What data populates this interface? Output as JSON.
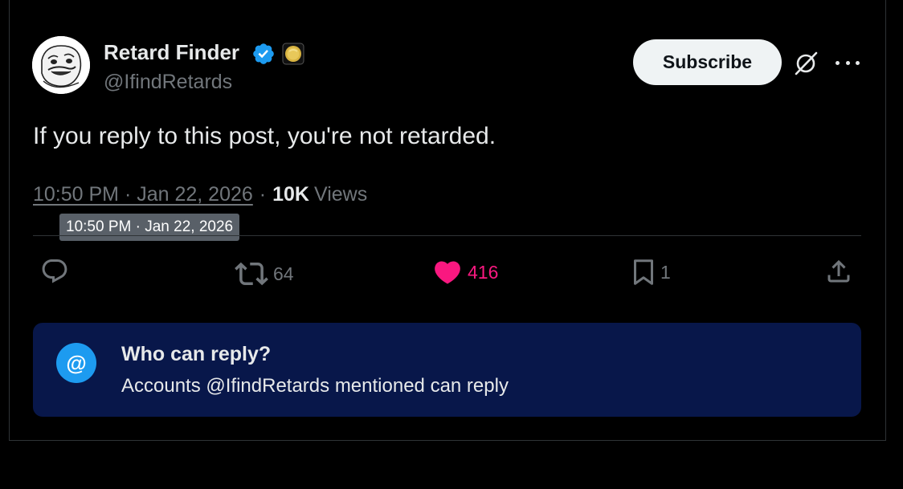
{
  "author": {
    "display_name": "Retard Finder",
    "handle": "@IfindRetards",
    "verified": true
  },
  "header": {
    "subscribe_label": "Subscribe"
  },
  "post": {
    "text": "If you reply to this post, you're not retarded.",
    "timestamp": "10:50 PM · Jan 22, 2026",
    "views_count": "10K",
    "views_label": "Views",
    "separator": "·"
  },
  "tooltip": {
    "text": "10:50 PM · Jan 22, 2026"
  },
  "actions": {
    "reposts": "64",
    "likes": "416",
    "bookmarks": "1"
  },
  "reply_restriction": {
    "icon_glyph": "@",
    "title": "Who can reply?",
    "subtitle": "Accounts @IfindRetards mentioned can reply"
  },
  "colors": {
    "background": "#000000",
    "like_active": "#f91880",
    "verified_blue": "#1d9bf0",
    "reply_box_bg": "#08174a",
    "muted_text": "#71767b"
  },
  "icons": [
    "avatar-image",
    "verified-badge-icon",
    "coin-badge-icon",
    "grok-icon",
    "more-icon",
    "reply-icon",
    "repost-icon",
    "like-icon",
    "bookmark-icon",
    "share-icon",
    "at-icon"
  ]
}
